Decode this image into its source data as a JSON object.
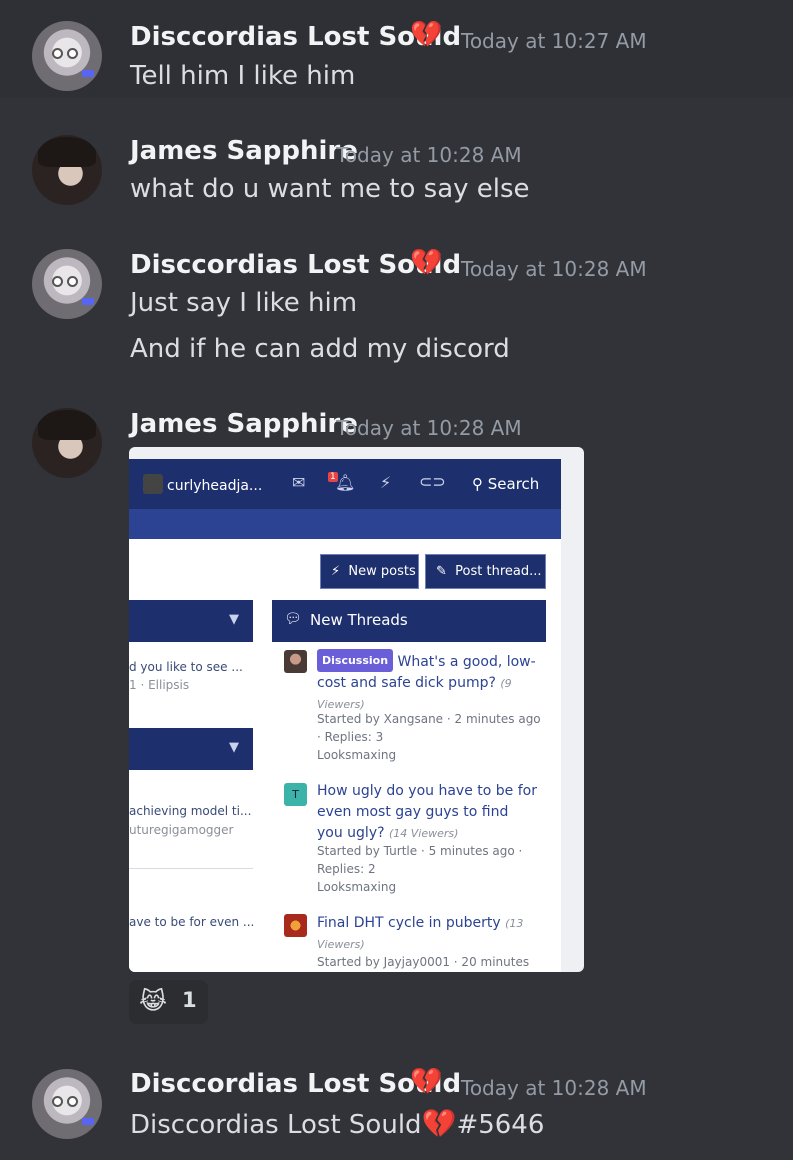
{
  "messages": [
    {
      "author": "Disccordias Lost Sould",
      "badge": "💔",
      "time": "Today at 10:27 AM",
      "lines": [
        "Tell him I like him"
      ]
    },
    {
      "author": "James Sapphire",
      "time": "Today at 10:28 AM",
      "lines": [
        "what do u want me to say else"
      ]
    },
    {
      "author": "Disccordias Lost Sould",
      "badge": "💔",
      "time": "Today at 10:28 AM",
      "lines": [
        "Just say I like him",
        "And if he can add my discord"
      ]
    },
    {
      "author": "James Sapphire",
      "time": "Today at 10:28 AM",
      "lines": []
    },
    {
      "author": "Disccordias Lost Sould",
      "badge": "💔",
      "time": "Today at 10:28 AM",
      "lines": [
        "Disccordias Lost Sould",
        "#5646"
      ]
    }
  ],
  "attachment": {
    "nav": {
      "username": "curlyheadja...",
      "notif_count": "1",
      "search": "Search"
    },
    "buttons": {
      "new_posts": "New posts",
      "post_thread": "Post thread..."
    },
    "new_threads_title": "New Threads",
    "left_fragments": [
      "d you like to see ...",
      "1 · Ellipsis",
      "achieving model ti...",
      "uturegigamogger",
      "ave to be for even ..."
    ],
    "threads": [
      {
        "tag": "Discussion",
        "title": "What's a good, low-cost and safe dick pump?",
        "viewers": "(9 Viewers)",
        "meta": "Started by Xangsane · 2 minutes ago · Replies: 3",
        "forum": "Looksmaxing"
      },
      {
        "avatar_letter": "T",
        "title": "How ugly do you have to be for even most gay guys to find you ugly?",
        "viewers": "(14 Viewers)",
        "meta": "Started by Turtle · 5 minutes ago · Replies: 2",
        "forum": "Looksmaxing"
      },
      {
        "title": "Final DHT cycle in puberty",
        "viewers": "(13 Viewers)",
        "meta": "Started by Jayjay0001 · 20 minutes"
      }
    ]
  },
  "reaction": {
    "emoji": "😹",
    "count": "1"
  },
  "colors": {
    "background": "#313338",
    "name": "#f2f3f5",
    "timestamp": "#949ba4",
    "forum_nav": "#1e2f6e"
  }
}
